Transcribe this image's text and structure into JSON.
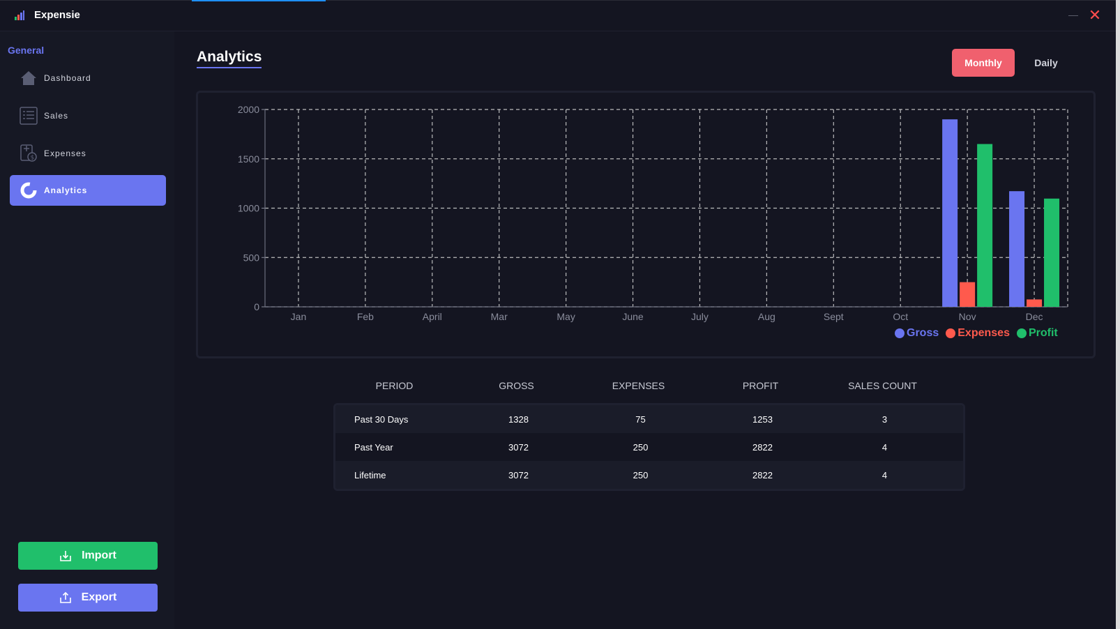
{
  "app": {
    "title": "Expensie"
  },
  "sidebar": {
    "heading": "General",
    "items": [
      {
        "label": "Dashboard",
        "icon": "home-icon"
      },
      {
        "label": "Sales",
        "icon": "list-icon"
      },
      {
        "label": "Expenses",
        "icon": "expenses-icon"
      },
      {
        "label": "Analytics",
        "icon": "donut-chart-icon",
        "active": true
      }
    ],
    "import_label": "Import",
    "export_label": "Export"
  },
  "page": {
    "title": "Analytics",
    "toggle": {
      "monthly": "Monthly",
      "daily": "Daily",
      "selected": "Monthly"
    }
  },
  "chart_data": {
    "type": "bar",
    "categories": [
      "Jan",
      "Feb",
      "April",
      "Mar",
      "May",
      "June",
      "July",
      "Aug",
      "Sept",
      "Oct",
      "Nov",
      "Dec"
    ],
    "series": [
      {
        "name": "Gross",
        "color": "#6a75f0",
        "values": [
          0,
          0,
          0,
          0,
          0,
          0,
          0,
          0,
          0,
          0,
          1900,
          1172
        ]
      },
      {
        "name": "Expenses",
        "color": "#ff5a4d",
        "values": [
          0,
          0,
          0,
          0,
          0,
          0,
          0,
          0,
          0,
          0,
          250,
          75
        ]
      },
      {
        "name": "Profit",
        "color": "#20bf6b",
        "values": [
          0,
          0,
          0,
          0,
          0,
          0,
          0,
          0,
          0,
          0,
          1650,
          1097
        ]
      }
    ],
    "ylim": [
      0,
      2000
    ],
    "yticks": [
      0,
      500,
      1000,
      1500,
      2000
    ],
    "grid": true,
    "legend": "bottom-right"
  },
  "table": {
    "headers": [
      "PERIOD",
      "GROSS",
      "EXPENSES",
      "PROFIT",
      "SALES COUNT"
    ],
    "rows": [
      [
        "Past 30 Days",
        "1328",
        "75",
        "1253",
        "3"
      ],
      [
        "Past Year",
        "3072",
        "250",
        "2822",
        "4"
      ],
      [
        "Lifetime",
        "3072",
        "250",
        "2822",
        "4"
      ]
    ]
  }
}
